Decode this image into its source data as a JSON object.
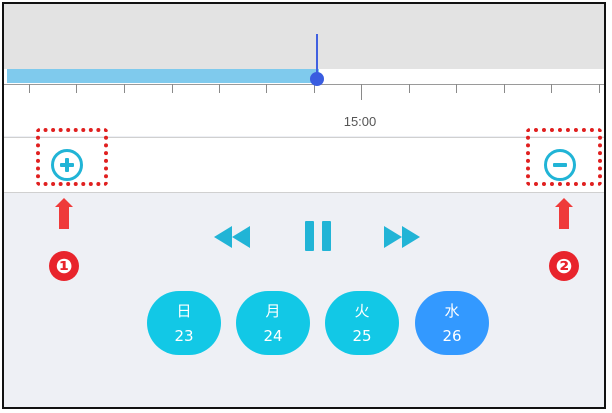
{
  "timeline": {
    "time_label": "15:00",
    "playback_progress": 0.52
  },
  "zoom": {
    "in_icon": "zoom-in-plus-icon",
    "out_icon": "zoom-out-minus-icon"
  },
  "callouts": {
    "badge_1": "❶",
    "badge_2": "❷"
  },
  "controls": {
    "rewind_icon": "rewind-icon",
    "pause_icon": "pause-icon",
    "forward_icon": "fast-forward-icon"
  },
  "days": [
    {
      "name": "日",
      "date": "23",
      "selected": false
    },
    {
      "name": "月",
      "date": "24",
      "selected": false
    },
    {
      "name": "火",
      "date": "25",
      "selected": false
    },
    {
      "name": "水",
      "date": "26",
      "selected": true
    }
  ],
  "colors": {
    "accent": "#12c8e6",
    "selected_day": "#3399ff",
    "playhead": "#3a5de0",
    "progress": "#7fcaed",
    "annotation_red": "#e02020"
  }
}
